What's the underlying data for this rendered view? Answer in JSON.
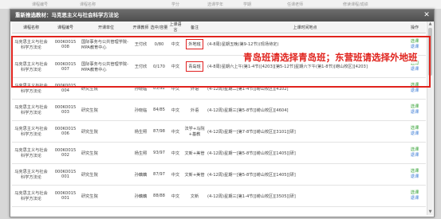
{
  "background_header": [
    "课程编号",
    "课程名称",
    "学分",
    "选课学年",
    "学期",
    "任课老师",
    "修读课程/成绩"
  ],
  "dialog": {
    "title": "重新推选教材：马克思主义与社会科学方法论",
    "close_icon": "close-icon"
  },
  "columns": [
    "课程名称",
    "课程编号",
    "开课单位",
    "开课教师",
    "选中/容量",
    "上课语言",
    "备注",
    "上课时间地点",
    "操作"
  ],
  "rows": [
    {
      "name": "马克思主义与社会科学方法论",
      "code": "000K0015 008",
      "dept": "国际事务与公共管理学院-MPA教育中心",
      "teacher": "王付欣",
      "cap": "0/80",
      "lang": "中文",
      "note": "外地班",
      "time": "(4-8周)星期五晚(第9-12节)(现场待定)",
      "ops": [
        "选课",
        "退课"
      ],
      "highlight": true
    },
    {
      "name": "马克思主义与社会科学方法论",
      "code": "000K0015 007",
      "dept": "国际事务与公共管理学院-MPA教育中心",
      "teacher": "王付欣",
      "cap": "0/170",
      "lang": "中文",
      "note": "青岛班",
      "time": "(4-8周)星期六上午(第1-4节)[4203][第5-12节]星期六下午(第1-8节)[崂山校区][4203]",
      "ops": [
        "选课",
        "退课"
      ],
      "highlight": true
    },
    {
      "name": "马克思主义与社会科学方法论",
      "code": "000K0015 004",
      "dept": "研究生院",
      "teacher": "孙晓临",
      "cap": "85/92",
      "lang": "中文",
      "note": "外语",
      "time": "(4-12周)星期二[第1-4节][崂山校区][4102]",
      "ops": [
        "选课",
        "退课"
      ],
      "highlight": false
    },
    {
      "name": "马克思主义与社会科学方法论",
      "code": "000K0015 003",
      "dept": "研究生院",
      "teacher": "孙晓临",
      "cap": "84/85",
      "lang": "中文",
      "note": "外语",
      "time": "(4-12周)星期三[第5-8节][崂山校区][4604]",
      "ops": [
        "选课",
        "退课"
      ],
      "highlight": false
    },
    {
      "name": "马克思主义与社会科学方法论",
      "code": "000K0015 006",
      "dept": "研究生院",
      "teacher": "杨生照",
      "cap": "87/98",
      "lang": "中文",
      "note": "法学+马院+基教",
      "time": "(4-12周)星期一[第7-8节][崂山校区][3101][研]",
      "ops": [
        "选课",
        "退课"
      ],
      "highlight": false
    },
    {
      "name": "马克思主义与社会科学方法论",
      "code": "000K0015 002",
      "dept": "研究生院",
      "teacher": "杨生照",
      "cap": "93/97",
      "lang": "中文",
      "note": "文新+美管",
      "time": "(4-12周)星期一[第5-8节][崂山校区][1405][研]",
      "ops": [
        "选课",
        "退课"
      ],
      "highlight": false
    },
    {
      "name": "马克思主义与社会科学方法论",
      "code": "000K0015 001",
      "dept": "研究生院",
      "teacher": "孙藕藕",
      "cap": "87/97",
      "lang": "中文",
      "note": "文新+美管",
      "time": "(4-12周)星期一[第5-8节][崂山校区][1405][研]",
      "ops": [
        "选课",
        "退课"
      ],
      "highlight": false
    },
    {
      "name": "马克思主义与社会科学方法论",
      "code": "000K0015 001",
      "dept": "研究生院",
      "teacher": "孙藕藕",
      "cap": "88/88",
      "lang": "中文",
      "note": "文新",
      "time": "(4-12周)星期三[第1-4节][崂山校区][3505][研]",
      "ops": [
        "选课",
        "退课"
      ],
      "highlight": false
    }
  ],
  "annotation": "青岛班请选择青岛班；东营班请选择外地班",
  "colors": {
    "annotation": "#e0231d",
    "select": "#2a9d2a",
    "retreat": "#3a7bd5",
    "title_bar": "#5a5a5a"
  }
}
